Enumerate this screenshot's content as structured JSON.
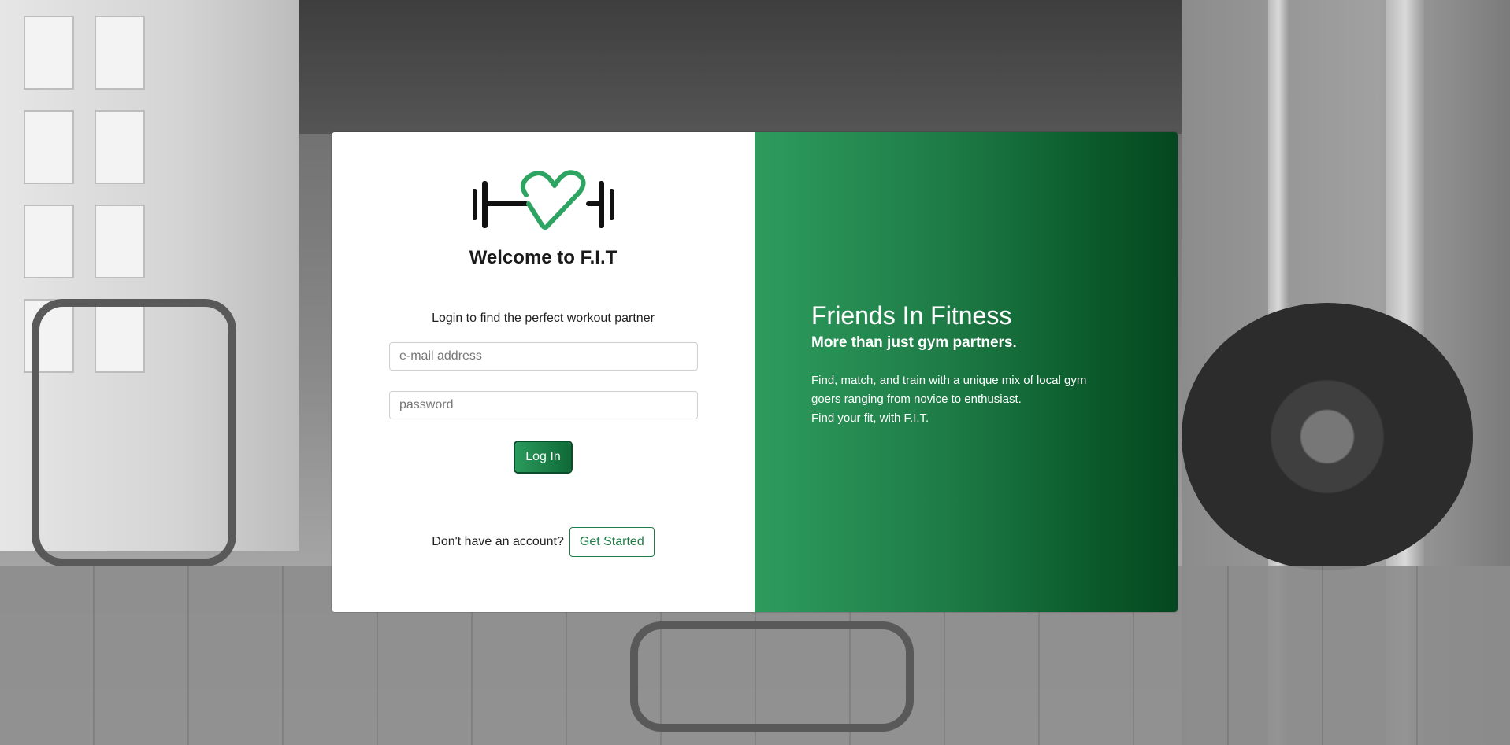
{
  "login": {
    "logo_icon": "heart-barbell-logo-icon",
    "welcome_title": "Welcome to F.I.T",
    "subtitle": "Login to find the perfect workout partner",
    "email_placeholder": "e-mail address",
    "password_placeholder": "password",
    "login_button": "Log In",
    "signup_prompt": "Don't have an account?",
    "get_started_button": "Get Started"
  },
  "brand": {
    "title": "Friends In Fitness",
    "tagline": "More than just gym partners.",
    "description_lines": [
      "Find, match, and train with a unique mix of local gym",
      "goers ranging from novice to enthusiast.",
      "Find your fit, with F.I.T."
    ]
  },
  "colors": {
    "accent_green": "#2e9c5e",
    "dark_green": "#04471f",
    "logo_green": "#2ea462"
  }
}
